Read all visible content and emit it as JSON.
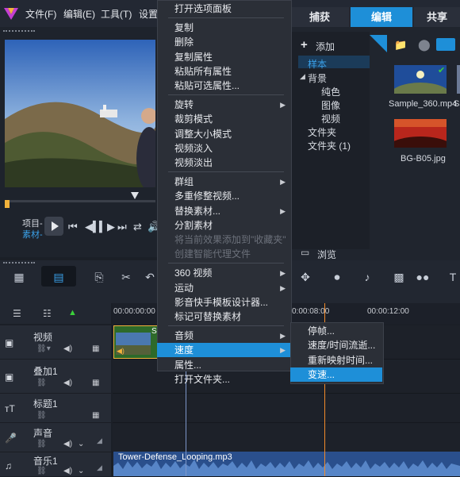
{
  "menubar": {
    "items": [
      "文件(F)",
      "编辑(E)",
      "工具(T)",
      "设置"
    ],
    "tabs": [
      {
        "label": "捕获",
        "active": false
      },
      {
        "label": "编辑",
        "active": true
      },
      {
        "label": "共享",
        "active": false
      }
    ]
  },
  "player": {
    "mode_project": "项目-",
    "mode_clip": "素材-"
  },
  "library": {
    "add_label": "添加",
    "tree": [
      {
        "label": "样本",
        "level": 0,
        "selected": true
      },
      {
        "label": "背景",
        "level": 0,
        "expanded": true
      },
      {
        "label": "纯色",
        "level": 1
      },
      {
        "label": "图像",
        "level": 1
      },
      {
        "label": "视频",
        "level": 1
      },
      {
        "label": "文件夹",
        "level": 0
      },
      {
        "label": "文件夹 (1)",
        "level": 0
      }
    ],
    "browse_label": "浏览",
    "thumbnails": [
      {
        "name": "Sample_360.mp4"
      },
      {
        "name": "Sa"
      },
      {
        "name": "BG-B05.jpg"
      }
    ]
  },
  "timeline": {
    "timecodes": [
      "00:00:00:00",
      "0:00:08:00",
      "00:00:12:00"
    ],
    "tracks": [
      {
        "name": "视频"
      },
      {
        "name": "叠加1"
      },
      {
        "name": "标题1"
      },
      {
        "name": "声音"
      },
      {
        "name": "音乐1"
      }
    ],
    "audio_clip": "Tower-Defense_Looping.mp3",
    "video_clip_label": "S"
  },
  "context_menu": {
    "groups": [
      [
        {
          "label": "打开选项面板"
        }
      ],
      [
        {
          "label": "复制"
        },
        {
          "label": "删除"
        },
        {
          "label": "复制属性"
        },
        {
          "label": "粘贴所有属性"
        },
        {
          "label": "粘贴可选属性..."
        }
      ],
      [
        {
          "label": "旋转",
          "submenu": true
        },
        {
          "label": "裁剪模式"
        },
        {
          "label": "调整大小模式"
        },
        {
          "label": "视频淡入"
        },
        {
          "label": "视频淡出"
        }
      ],
      [
        {
          "label": "群组",
          "submenu": true
        },
        {
          "label": "多重修整视频..."
        },
        {
          "label": "替换素材...",
          "submenu": true
        },
        {
          "label": "分割素材"
        },
        {
          "label": "将当前效果添加到\"收藏夹\"",
          "disabled": true
        },
        {
          "label": "创建智能代理文件",
          "disabled": true
        }
      ],
      [
        {
          "label": "360 视频",
          "submenu": true
        },
        {
          "label": "运动",
          "submenu": true
        },
        {
          "label": "影音快手模板设计器..."
        },
        {
          "label": "标记可替换素材"
        }
      ],
      [
        {
          "label": "音频",
          "submenu": true
        },
        {
          "label": "速度",
          "submenu": true,
          "highlighted": true
        },
        {
          "label": "属性..."
        },
        {
          "label": "打开文件夹..."
        }
      ]
    ]
  },
  "speed_submenu": [
    {
      "label": "停帧..."
    },
    {
      "label": "速度/时间流逝..."
    },
    {
      "label": "重新映射时间..."
    },
    {
      "label": "变速...",
      "highlighted": true
    }
  ]
}
